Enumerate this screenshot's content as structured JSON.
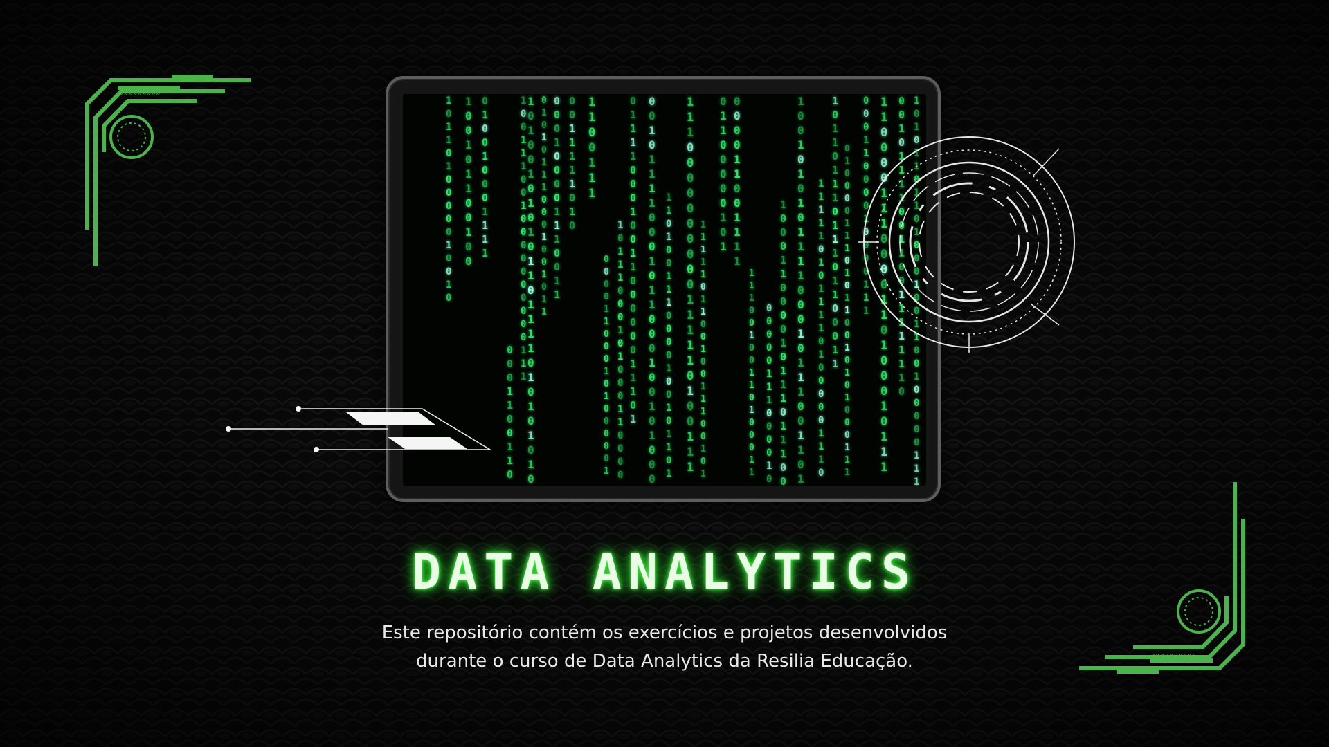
{
  "title": "DATA ANALYTICS",
  "description": "Este repositório contém os exercícios e projetos desenvolvidos durante o curso de Data Analytics da Resilia Educação.",
  "colors": {
    "background": "#0a0a0a",
    "accent_green": "#4cb34c",
    "matrix_green": "#2ee86a",
    "hud_white": "#e6e6e6"
  },
  "icons": [
    "corner-bracket-icon",
    "hud-target-icon",
    "binary-rain-screen"
  ]
}
